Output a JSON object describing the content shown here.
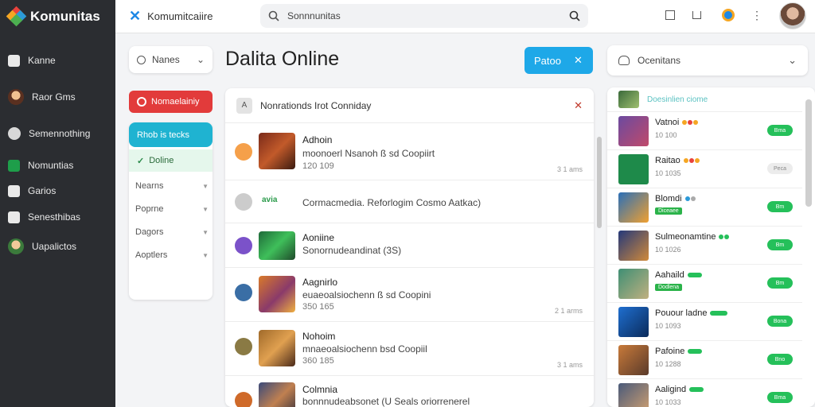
{
  "app": {
    "name": "Komunitas",
    "logo_colors": [
      "#e8423c",
      "#f5a623",
      "#2c9ad8",
      "#4caf50"
    ]
  },
  "sidebar": {
    "items": [
      {
        "label": "Kanne",
        "icon": "home-icon"
      },
      {
        "label": "Raor Gms",
        "icon": "avatar-icon"
      },
      {
        "label": "Semennothing",
        "icon": "gamepad-icon"
      },
      {
        "label": "Nomuntias",
        "icon": "community-icon"
      },
      {
        "label": "Garios",
        "icon": "play-icon"
      },
      {
        "label": "Senesthibas",
        "icon": "controller-icon"
      },
      {
        "label": "Uapalictos",
        "icon": "avatar-icon"
      }
    ]
  },
  "topbar": {
    "site_title": "Komumitcaiire",
    "search_placeholder": "Sonnnunitas"
  },
  "filters": {
    "dropdown_label": "Nanes",
    "red_button_label": "Nomaelainiy",
    "cyan_button_label": "Rhob is tecks",
    "online_label": "Doline",
    "rows": [
      "Nearns",
      "Poprne",
      "Dagors",
      "Aoptlers"
    ]
  },
  "main": {
    "heading": "Dalita Online",
    "action_button_label": "Patoo",
    "feed_header": "Nonrationds Irot Conniday",
    "posts": [
      {
        "name": "Adhoin",
        "desc": "moonoerl Nsanoh ß sd Coopiirt",
        "count": "120 109",
        "stat": "3 1 ams",
        "dot_color": "#f5a04a"
      },
      {
        "name": "",
        "desc": "Cormacmedia. Reforlogim Cosmo Aatkac)",
        "count": "",
        "stat": "",
        "dot_color": "#cccccc",
        "logo": "avia"
      },
      {
        "name": "Aoniine",
        "desc": "Sonornudeandinat (3S)",
        "count": "",
        "stat": "",
        "dot_color": "#7b52c9"
      },
      {
        "name": "Aagnirlo",
        "desc": "euaeoalsiochenn ß sd Coopini",
        "count": "350 165",
        "stat": "2 1 arms",
        "dot_color": "#3a6ea5"
      },
      {
        "name": "Nohoim",
        "desc": "mnaeoalsiochenn bsd Coopiil",
        "count": "360 185",
        "stat": "3 1 ams",
        "dot_color": "#8a7a44"
      },
      {
        "name": "Colmnia",
        "desc": "bonnnudeabsonet (U Seals oriorrenerel",
        "count": "",
        "stat": "",
        "dot_color": "#cf6a2a"
      }
    ]
  },
  "friends": {
    "dropdown_label": "Ocenitans",
    "header_label": "Doesinlien ciome",
    "list": [
      {
        "name": "Vatnoi",
        "sub": "10 100",
        "tag": "",
        "status": "Bma",
        "online": true,
        "thumb": "#6b4aa0"
      },
      {
        "name": "Raitao",
        "sub": "10 1035",
        "tag": "",
        "status": "Peca",
        "online": false,
        "thumb": "#1e8a4a"
      },
      {
        "name": "Blomdi",
        "sub": "",
        "tag": "Diceaee",
        "status": "Bm",
        "online": true,
        "thumb": "#2a6fb8"
      },
      {
        "name": "Sulmeonamtine",
        "sub": "10 1026",
        "tag": "",
        "status": "Bm",
        "online": true,
        "thumb": "#24387a"
      },
      {
        "name": "Aahaild",
        "sub": "",
        "tag": "Dodlena",
        "status": "Bm",
        "online": true,
        "thumb": "#3f8f74"
      },
      {
        "name": "Pouour ladne",
        "sub": "10 1093",
        "tag": "",
        "status": "Bona",
        "online": true,
        "thumb": "#1f6fd0"
      },
      {
        "name": "Pafoine",
        "sub": "10 1288",
        "tag": "",
        "status": "Bno",
        "online": true,
        "thumb": "#c87a3a"
      },
      {
        "name": "Aaligind",
        "sub": "10 1033",
        "tag": "",
        "status": "Bma",
        "online": true,
        "thumb": "#4a5a7a"
      }
    ]
  }
}
